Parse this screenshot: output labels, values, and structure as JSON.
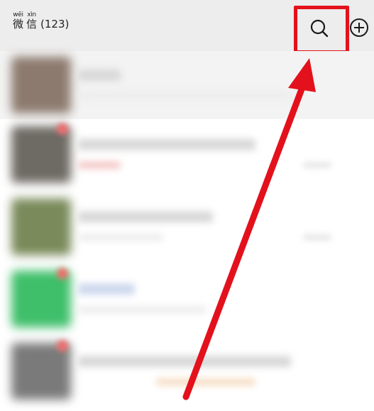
{
  "header": {
    "title_chars": [
      {
        "pinyin": "wēi",
        "hanzi": "微"
      },
      {
        "pinyin": "xìn",
        "hanzi": "信"
      }
    ],
    "unread_count": "(123)",
    "search_icon": "search-icon",
    "add_icon": "plus-circle-icon"
  },
  "colors": {
    "header_bg": "#ededed",
    "highlight_red": "#e3111c",
    "arrow_red": "#e3111c"
  },
  "chats": [
    {
      "pinned": true,
      "avatar_color": "#8c7a6e",
      "unread": false
    },
    {
      "pinned": false,
      "avatar_color": "#6e6a64",
      "unread": true
    },
    {
      "pinned": false,
      "avatar_color": "#7a8a5a",
      "unread": false
    },
    {
      "pinned": false,
      "avatar_color": "#3fbf6a",
      "unread": true
    },
    {
      "pinned": false,
      "avatar_color": "#7a7a7a",
      "unread": true
    }
  ]
}
